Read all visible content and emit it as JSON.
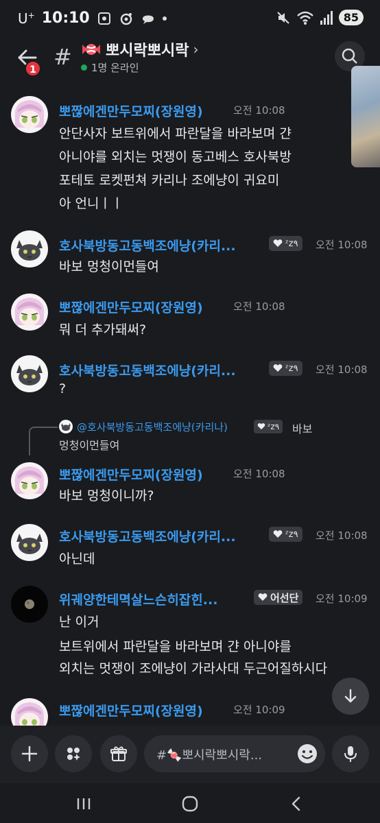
{
  "status_bar": {
    "carrier": "U",
    "carrier_sup": "+",
    "time": "10:10",
    "battery": "85"
  },
  "header": {
    "channel_hash": "#",
    "channel_name": "뽀시락뽀시락",
    "channel_emoji": "candy",
    "chevron": "›",
    "online_status": "1명 온라인",
    "back_badge": "1"
  },
  "messages": [
    {
      "author": "뽀짢에겐만두모찌(장원영)",
      "time": "오전 10:08",
      "avatar": "pink-hair-girl",
      "lines": [
        "안단사자 보트위에서 파란달을 바라보며 갼",
        "아니야를 외치는 멋쟁이 동고베스 호사북방",
        "포테토 로켓펀쳐 카리나 조에냥이 귀요미",
        "아 언니ㅣㅣ"
      ]
    },
    {
      "author": "호사북방동고동백조에냥(카리...",
      "time": "오전 10:08",
      "avatar": "gray-cat",
      "tag": "ᶻz٩",
      "lines": [
        "바보 멍청이먼들여"
      ]
    },
    {
      "author": "뽀짢에겐만두모찌(장원영)",
      "time": "오전 10:08",
      "avatar": "pink-hair-girl",
      "lines": [
        "뭐 더 추가돼써?"
      ]
    },
    {
      "author": "호사북방동고동백조에냥(카리...",
      "time": "오전 10:08",
      "avatar": "gray-cat",
      "tag": "ᶻz٩",
      "lines": [
        "?"
      ]
    },
    {
      "reply": {
        "author": "@호사북방동고동백조에냥(카리나)",
        "tag": "ᶻz٩",
        "text_1": "바보",
        "text_2": "멍청이먼들여"
      },
      "author": "뽀짢에겐만두모찌(장원영)",
      "time": "오전 10:08",
      "avatar": "pink-hair-girl",
      "lines": [
        "바보 멍청이니까?"
      ]
    },
    {
      "author": "호사북방동고동백조에냥(카리...",
      "time": "오전 10:08",
      "avatar": "gray-cat",
      "tag": "ᶻz٩",
      "lines": [
        "아닌데"
      ]
    },
    {
      "author": "위궤양한테멱살느슨히잡힌...",
      "time": "오전 10:09",
      "avatar": "moon",
      "tag": "어선단",
      "lines": [
        "난 이거",
        "보트위에서 파란달을 바라보며 갼 아니야를",
        "외치는 멋쟁이 조에냥이 가라사대 두근어질하시다"
      ]
    },
    {
      "author": "뽀짢에겐만두모찌(장원영)",
      "time": "오전 10:09",
      "avatar": "pink-hair-girl",
      "lines": []
    }
  ],
  "composer": {
    "placeholder": "#🍬뽀시락뽀시락..."
  },
  "colors": {
    "background": "#1a1b1e",
    "username": "#3a9bf0",
    "online": "#23a55a",
    "badge": "#e5343d"
  }
}
